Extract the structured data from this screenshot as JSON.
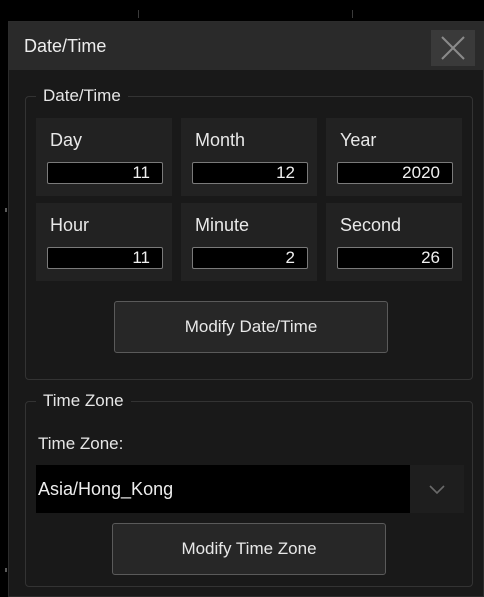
{
  "dialog": {
    "title": "Date/Time",
    "close_icon": "close-icon"
  },
  "datetime_group": {
    "legend": "Date/Time",
    "fields": [
      {
        "label": "Day",
        "value": "11"
      },
      {
        "label": "Month",
        "value": "12"
      },
      {
        "label": "Year",
        "value": "2020"
      },
      {
        "label": "Hour",
        "value": "11"
      },
      {
        "label": "Minute",
        "value": "2"
      },
      {
        "label": "Second",
        "value": "26"
      }
    ],
    "modify_button": "Modify Date/Time"
  },
  "timezone_group": {
    "legend": "Time Zone",
    "label": "Time Zone:",
    "selected": "Asia/Hong_Kong",
    "dropdown_icon": "chevron-down-icon",
    "modify_button": "Modify Time Zone"
  },
  "colors": {
    "background": "#000000",
    "panel": "#191919",
    "titlebar": "#2a2a2a",
    "cell": "#222222",
    "text": "#e6e6e6"
  }
}
